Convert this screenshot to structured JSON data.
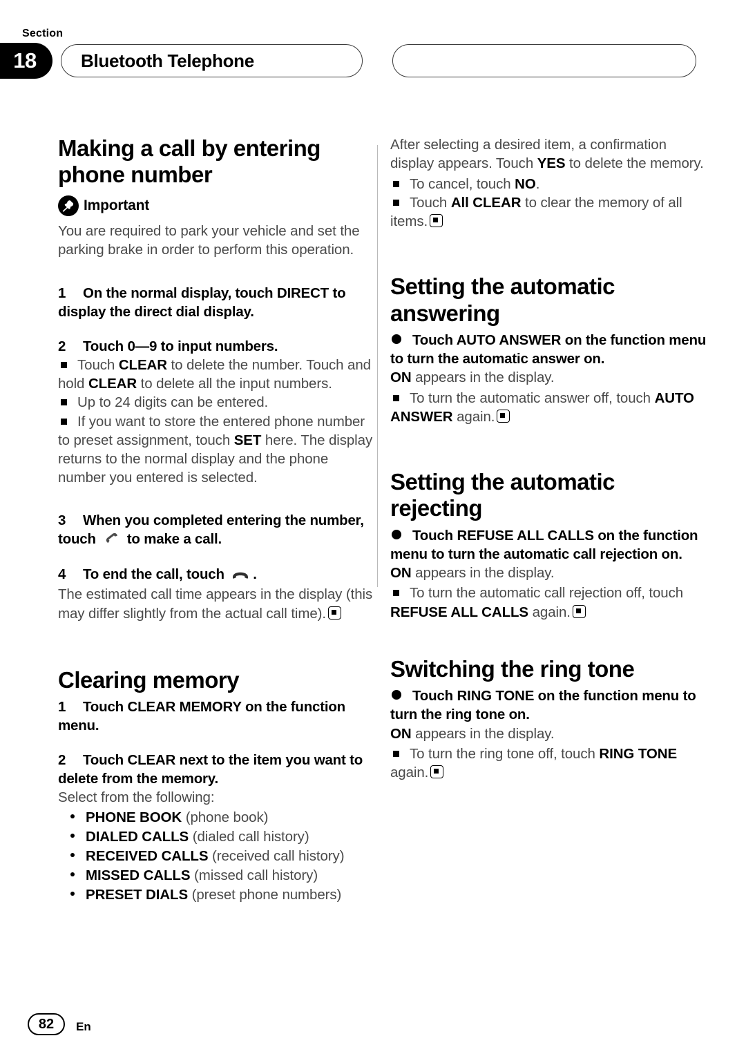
{
  "header": {
    "section_label": "Section",
    "section_number": "18",
    "chapter_title": "Bluetooth Telephone",
    "right_pill_title": ""
  },
  "footer": {
    "page_number": "82",
    "language": "En"
  },
  "left_column": {
    "heading_1": "Making a call by entering phone number",
    "important_label": "Important",
    "important_icon": "pushpin-icon",
    "important_body": "You are required to park your vehicle and set the parking brake in order to perform this operation.",
    "step1_num": "1",
    "step1_text": "On the normal display, touch DIRECT to display the direct dial display.",
    "step2_num": "2",
    "step2_text": "Touch 0—9 to input numbers.",
    "note1_pre": "Touch ",
    "note1_bold1": "CLEAR",
    "note1_mid": " to delete the number. Touch and hold ",
    "note1_bold2": "CLEAR",
    "note1_post": " to delete all the input numbers.",
    "note2": "Up to 24 digits can be entered.",
    "note3_pre": "If you want to store the entered phone number to preset assignment, touch ",
    "note3_bold": "SET",
    "note3_post": " here. The display returns to the normal display and the phone number you entered is selected.",
    "step3_num": "3",
    "step3_pre": "When you completed entering the number, touch ",
    "step3_icon": "phone-offhook-icon",
    "step3_post": " to make a call.",
    "step4_num": "4",
    "step4_pre": "To end the call, touch ",
    "step4_icon": "phone-onhook-icon",
    "step4_post": ".",
    "step4_body": "The estimated call time appears in the display (this may differ slightly from the actual call time).",
    "heading_2": "Clearing memory",
    "cm_step1_num": "1",
    "cm_step1_text": "Touch CLEAR MEMORY on the function menu.",
    "cm_step2_num": "2",
    "cm_step2_text": "Touch CLEAR next to the item you want to delete from the memory.",
    "cm_select_intro": "Select from the following:",
    "cm_options": [
      {
        "term": "PHONE BOOK",
        "desc": "(phone book)"
      },
      {
        "term": "DIALED CALLS",
        "desc": "(dialed call history)"
      },
      {
        "term": "RECEIVED CALLS",
        "desc": "(received call history)"
      },
      {
        "term": "MISSED CALLS",
        "desc": "(missed call history)"
      },
      {
        "term": "PRESET DIALS",
        "desc": "(preset phone numbers)"
      }
    ]
  },
  "right_column": {
    "intro_pre": "After selecting a desired item, a confirmation display appears. Touch ",
    "intro_bold": "YES",
    "intro_post": " to delete the memory.",
    "intro_note1_pre": "To cancel, touch ",
    "intro_note1_bold": "NO",
    "intro_note1_post": ".",
    "intro_note2_pre": "Touch ",
    "intro_note2_bold": "All CLEAR",
    "intro_note2_post": " to clear the memory of all items.",
    "heading_1": "Setting the automatic answering",
    "aa_step": "Touch AUTO ANSWER on the function menu to turn the automatic answer on.",
    "aa_on_bold": "ON",
    "aa_on_rest": " appears in the display.",
    "aa_note_pre": "To turn the automatic answer off, touch ",
    "aa_note_bold": "AUTO ANSWER",
    "aa_note_post": " again.",
    "heading_2": "Setting the automatic rejecting",
    "ar_step": "Touch REFUSE ALL CALLS on the function menu to turn the automatic call rejection on.",
    "ar_on_bold": "ON",
    "ar_on_rest": " appears in the display.",
    "ar_note_pre": "To turn the automatic call rejection off, touch ",
    "ar_note_bold": "REFUSE ALL CALLS",
    "ar_note_post": " again.",
    "heading_3": "Switching the ring tone",
    "rt_step": "Touch RING TONE on the function menu to turn the ring tone on.",
    "rt_on_bold": "ON",
    "rt_on_rest": " appears in the display.",
    "rt_note_pre": "To turn the ring tone off, touch ",
    "rt_note_bold": "RING TONE",
    "rt_note_post": " again."
  },
  "colors": {
    "ink": "#000000",
    "body_gray": "#4a4a4a",
    "rule": "#b9b9b9"
  }
}
